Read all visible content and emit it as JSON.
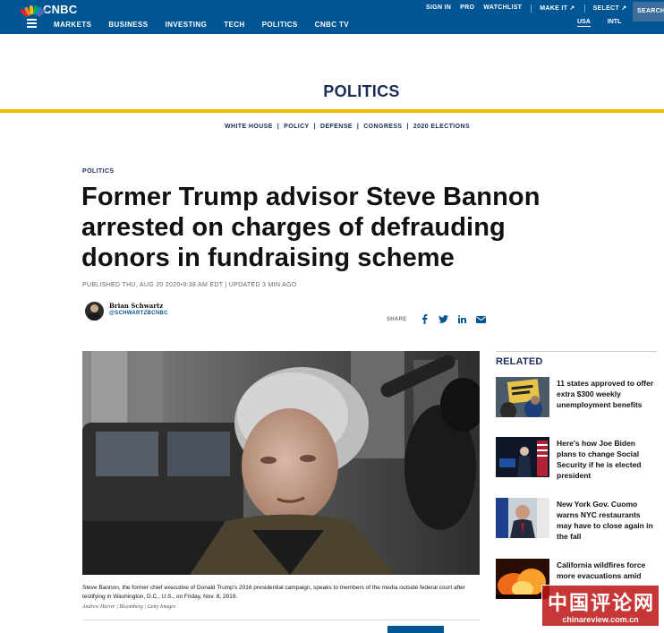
{
  "brand": {
    "logo_text": "CNBC",
    "peacock_colors": [
      "#e7212f",
      "#f58220",
      "#fdb913",
      "#00a850",
      "#0089d0",
      "#6460aa"
    ]
  },
  "topnav": {
    "main": [
      "MARKETS",
      "BUSINESS",
      "INVESTING",
      "TECH",
      "POLITICS",
      "CNBC TV"
    ],
    "utility": [
      "SIGN IN",
      "PRO",
      "WATCHLIST"
    ],
    "make_it": "MAKE IT ↗",
    "select": "SELECT ↗",
    "search": "SEARCH",
    "region": [
      "USA",
      "INTL"
    ]
  },
  "section": {
    "title": "POLITICS",
    "subnav": [
      "WHITE HOUSE",
      "POLICY",
      "DEFENSE",
      "CONGRESS",
      "2020 ELECTIONS"
    ]
  },
  "article": {
    "kicker": "POLITICS",
    "headline": "Former Trump advisor Steve Bannon arrested on charges of defrauding donors in fundraising scheme",
    "published": "PUBLISHED THU, AUG 20 2020•9:38 AM EDT",
    "updated": "UPDATED 3 MIN AGO",
    "author_name": "Brian Schwartz",
    "author_handle": "@SCHWARTZBCNBC",
    "share_label": "SHARE",
    "share_icons": [
      "facebook-icon",
      "twitter-icon",
      "linkedin-icon",
      "email-icon"
    ],
    "caption": "Steve Bannon, the former chief executive of Donald Trump's 2016 presidential campaign, speaks to members of the media outside federal court after testifying in Washington, D.C., U.S., on Friday, Nov. 8, 2019.",
    "credit": "Andrew Harrer | Bloomberg | Getty Images"
  },
  "related": {
    "heading": "RELATED",
    "items": [
      {
        "title": "11 states approved to offer extra $300 weekly unemployment benefits"
      },
      {
        "title": "Here's how Joe Biden plans to change Social Security if he is elected president"
      },
      {
        "title": "New York Gov. Cuomo warns NYC restaurants may have to close again in the fall"
      },
      {
        "title": "California wildfires force more evacuations amid"
      }
    ]
  },
  "watermark": {
    "chinese": "中国评论网",
    "url": "chinareview.com.cn"
  },
  "colors": {
    "nav_blue": "#005594",
    "section_navy": "#1a2d5a",
    "accent_yellow": "#f5b800"
  }
}
